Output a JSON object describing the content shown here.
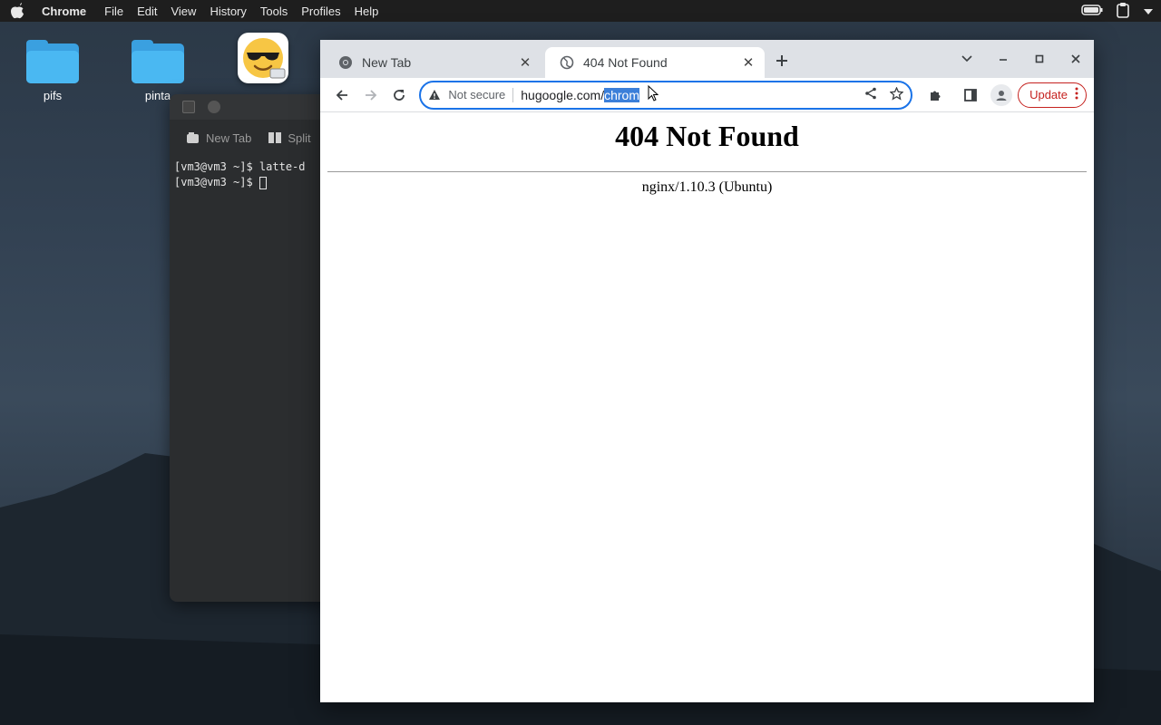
{
  "menubar": {
    "app_name": "Chrome",
    "items": [
      "File",
      "Edit",
      "View",
      "History",
      "Tools",
      "Profiles",
      "Help"
    ]
  },
  "desktop": {
    "icons": [
      {
        "label": "pifs"
      },
      {
        "label": "pinta"
      }
    ]
  },
  "terminal": {
    "tabs": [
      "New Tab",
      "Split"
    ],
    "lines": [
      "[vm3@vm3 ~]$ latte-d",
      "[vm3@vm3 ~]$ "
    ]
  },
  "browser": {
    "tabs": [
      {
        "title": "New Tab"
      },
      {
        "title": "404 Not Found"
      }
    ],
    "omnibox": {
      "security_label": "Not secure",
      "url_plain": "hugoogle.com/",
      "url_selected": "chrom"
    },
    "update_label": "Update",
    "page": {
      "heading": "404 Not Found",
      "server": "nginx/1.10.3 (Ubuntu)"
    }
  },
  "colors": {
    "accent": "#1a73e8",
    "update": "#c5221f",
    "folder": "#4ab8f2",
    "selection": "#3b7fd9"
  }
}
